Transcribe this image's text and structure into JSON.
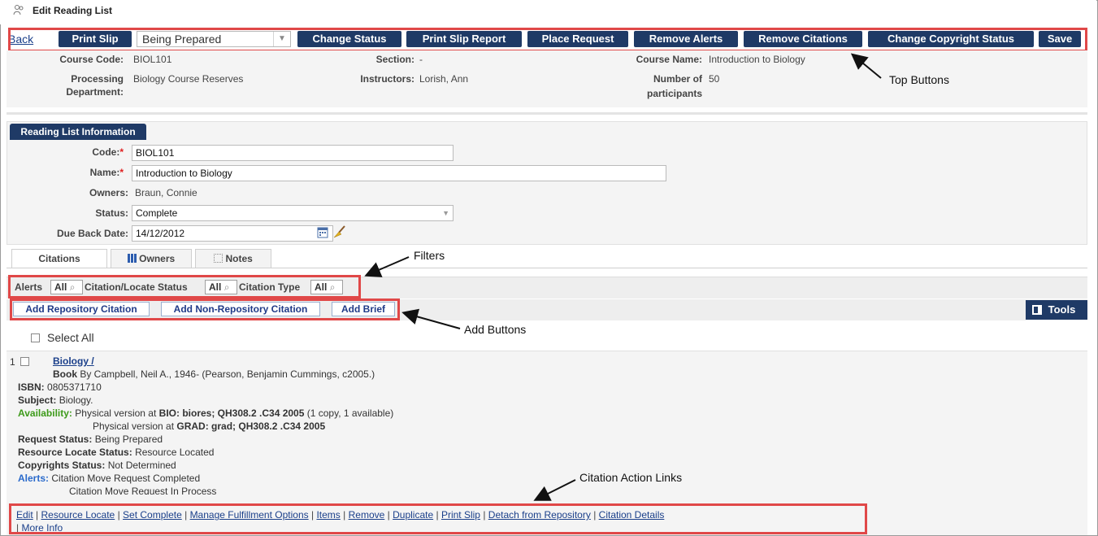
{
  "window": {
    "title": "Edit Reading List"
  },
  "toolbar": {
    "back_label": "Back",
    "print_slip_label": "Print Slip",
    "status_select_value": "Being Prepared",
    "change_status_label": "Change Status",
    "print_slip_report_label": "Print Slip Report",
    "place_request_label": "Place Request",
    "remove_alerts_label": "Remove Alerts",
    "remove_citations_label": "Remove Citations",
    "change_copyright_label": "Change Copyright Status",
    "save_label": "Save"
  },
  "course": {
    "code_label": "Course Code:",
    "code_value": "BIOL101",
    "section_label": "Section:",
    "section_value": "-",
    "name_label": "Course Name:",
    "name_value": "Introduction to Biology",
    "processing_label_1": "Processing",
    "processing_label_2": "Department:",
    "processing_value": "Biology Course Reserves",
    "instructors_label": "Instructors:",
    "instructors_value": "Lorish, Ann",
    "participants_label_1": "Number of",
    "participants_label_2": "participants",
    "participants_value": "50"
  },
  "reading_list": {
    "section_title": "Reading List Information",
    "code_label": "Code:",
    "code_value": "BIOL101",
    "name_label": "Name:",
    "name_value": "Introduction to Biology",
    "owners_label": "Owners:",
    "owners_value": "Braun, Connie",
    "status_label": "Status:",
    "status_value": "Complete",
    "due_back_label": "Due Back Date:",
    "due_back_value": "14/12/2012",
    "required_mark": "*"
  },
  "tabs": {
    "citations": "Citations",
    "owners": "Owners",
    "notes": "Notes"
  },
  "filters": {
    "alerts_label": "Alerts",
    "alerts_value": "All",
    "status_label": "Citation/Locate Status",
    "status_value": "All",
    "type_label": "Citation Type",
    "type_value": "All"
  },
  "add_buttons": {
    "repository": "Add Repository Citation",
    "non_repository": "Add Non-Repository Citation",
    "brief": "Add Brief",
    "tools": "Tools"
  },
  "select_all_label": "Select All",
  "citation": {
    "index": "1",
    "title": "Biology /",
    "type": "Book",
    "byline": "By Campbell, Neil A., 1946- (Pearson, Benjamin Cummings, c2005.)",
    "isbn_label": "ISBN:",
    "isbn_value": "0805371710",
    "subject_label": "Subject:",
    "subject_value": "Biology.",
    "availability_label": "Availability:",
    "avail1_prefix": "Physical version at",
    "avail1_bold": "BIO: biores; QH308.2 .C34 2005",
    "avail1_suffix": "(1 copy, 1 available)",
    "avail2_prefix": "Physical version at",
    "avail2_bold": "GRAD: grad; QH308.2 .C34 2005",
    "request_label": "Request Status:",
    "request_value": "Being Prepared",
    "locate_label": "Resource Locate Status:",
    "locate_value": "Resource Located",
    "copyright_label": "Copyrights Status:",
    "copyright_value": "Not Determined",
    "alerts_label": "Alerts:",
    "alert1": "Citation Move Request Completed",
    "alert2": "Citation Move Request In Process"
  },
  "actions": {
    "edit": "Edit",
    "resource_locate": "Resource Locate",
    "set_complete": "Set Complete",
    "manage_fulfillment": "Manage Fulfillment Options",
    "items": "Items",
    "remove": "Remove",
    "duplicate": "Duplicate",
    "print_slip": "Print Slip",
    "detach": "Detach from Repository",
    "details": "Citation Details",
    "more_info": "More Info",
    "separator": "|"
  },
  "annotations": {
    "top_buttons": "Top Buttons",
    "filters": "Filters",
    "add_buttons": "Add Buttons",
    "citation_action_links": "Citation Action Links"
  },
  "colors": {
    "button_navy": "#1f3a66",
    "highlight_red": "#e04848",
    "link_blue": "#1a3f8a",
    "availability_green": "#3d9a1a"
  }
}
